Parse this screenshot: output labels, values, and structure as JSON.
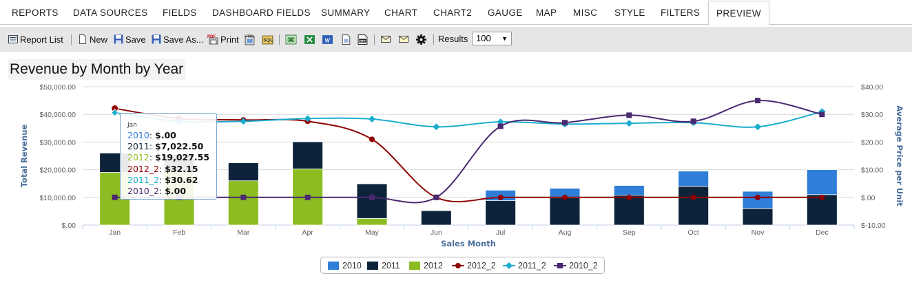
{
  "tabs": [
    {
      "label": "REPORTS",
      "active": false
    },
    {
      "label": "DATA SOURCES",
      "active": false
    },
    {
      "label": "FIELDS",
      "active": false
    },
    {
      "label": "DASHBOARD FIELDS",
      "active": false
    },
    {
      "label": "SUMMARY",
      "active": false
    },
    {
      "label": "CHART",
      "active": false
    },
    {
      "label": "CHART2",
      "active": false
    },
    {
      "label": "GAUGE",
      "active": false
    },
    {
      "label": "MAP",
      "active": false
    },
    {
      "label": "MISC",
      "active": false
    },
    {
      "label": "STYLE",
      "active": false
    },
    {
      "label": "FILTERS",
      "active": false
    },
    {
      "label": "PREVIEW",
      "active": true
    }
  ],
  "toolbar": {
    "report_list": "Report List",
    "new": "New",
    "save": "Save",
    "save_as": "Save As...",
    "print": "Print",
    "results_label": "Results",
    "results_value": "100",
    "icons": [
      "html-export-icon",
      "sql-icon",
      "excel-icon",
      "excel-alt-icon",
      "word-icon",
      "csv-icon",
      "rtf-icon",
      "email-icon",
      "email-alt-icon",
      "gear-icon"
    ]
  },
  "tooltip": {
    "header": "Jan",
    "rows": [
      {
        "name": "2010",
        "value": "$.00",
        "color": "#2f7ed8"
      },
      {
        "name": "2011",
        "value": "$7,022.50",
        "color": "#0d233a"
      },
      {
        "name": "2012",
        "value": "$19,027.55",
        "color": "#8bbc21"
      },
      {
        "name": "2012_2",
        "value": "$32.15",
        "color": "#910000"
      },
      {
        "name": "2011_2",
        "value": "$30.62",
        "color": "#1aadce"
      },
      {
        "name": "2010_2",
        "value": "$.00",
        "color": "#492970"
      }
    ]
  },
  "chart_data": {
    "type": "bar",
    "title": "Revenue by Month by Year",
    "xlabel": "Sales Month",
    "ylabel": "Total Revenue",
    "ylabel_right": "Average Price per Unit",
    "categories": [
      "Jan",
      "Feb",
      "Mar",
      "Apr",
      "May",
      "Jun",
      "Jul",
      "Aug",
      "Sep",
      "Oct",
      "Nov",
      "Dec"
    ],
    "ylim": [
      0,
      50000
    ],
    "ylim_right": [
      -10,
      40
    ],
    "yticks": [
      "$.00",
      "$10,000.00",
      "$20,000.00",
      "$30,000.00",
      "$40,000.00",
      "$50,000.00"
    ],
    "yticks_right": [
      "$-10.00",
      "$.00",
      "$10.00",
      "$20.00",
      "$30.00",
      "$40.00"
    ],
    "stacked": true,
    "grid": true,
    "legend_position": "bottom",
    "series": [
      {
        "name": "2010",
        "type": "bar",
        "axis": "left",
        "color": "#2f7ed8",
        "values": [
          0,
          0,
          0,
          0,
          0,
          0,
          3800,
          3500,
          3500,
          5500,
          6200,
          9000
        ]
      },
      {
        "name": "2011",
        "type": "bar",
        "axis": "left",
        "color": "#0d233a",
        "values": [
          7022.5,
          6000,
          6500,
          9800,
          12500,
          5200,
          8800,
          9800,
          10800,
          14000,
          6000,
          11000
        ]
      },
      {
        "name": "2012",
        "type": "bar",
        "axis": "left",
        "color": "#8bbc21",
        "values": [
          19027.55,
          19500,
          16000,
          20300,
          2400,
          0,
          0,
          0,
          0,
          0,
          0,
          0
        ]
      },
      {
        "name": "2012_2",
        "type": "line",
        "axis": "right",
        "color": "#910000",
        "values": [
          32.15,
          28.5,
          28,
          27.5,
          21,
          0,
          0,
          0,
          0,
          0,
          0,
          0
        ]
      },
      {
        "name": "2011_2",
        "type": "line",
        "axis": "right",
        "color": "#1aadce",
        "values": [
          30.62,
          27.5,
          27.5,
          28.5,
          28.3,
          25.5,
          27.3,
          26.5,
          26.8,
          27,
          25.5,
          31
        ]
      },
      {
        "name": "2010_2",
        "type": "line",
        "axis": "right",
        "color": "#492970",
        "values": [
          0,
          0,
          0,
          0,
          0,
          0,
          25.7,
          27,
          29.7,
          27.5,
          35,
          30
        ]
      }
    ]
  }
}
